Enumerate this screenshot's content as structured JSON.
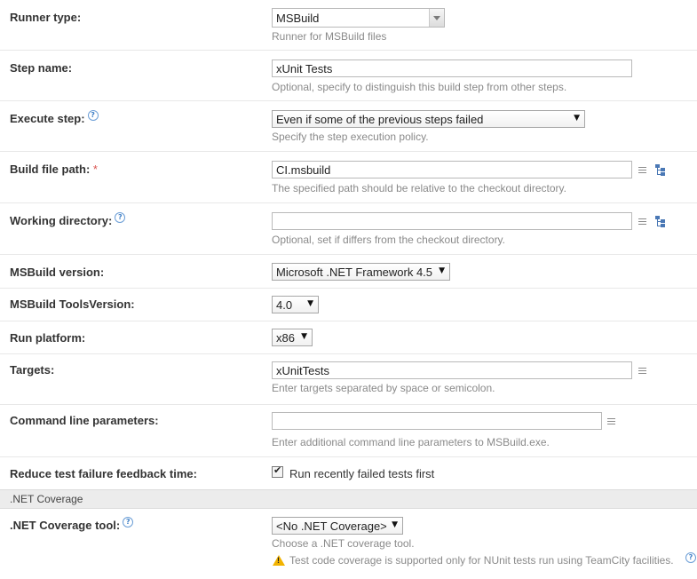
{
  "runner_type": {
    "label": "Runner type:",
    "value": "MSBuild",
    "note": "Runner for MSBuild files"
  },
  "step_name": {
    "label": "Step name:",
    "value": "xUnit Tests",
    "note": "Optional, specify to distinguish this build step from other steps."
  },
  "execute_step": {
    "label": "Execute step:",
    "help": "?",
    "value": "Even if some of the previous steps failed",
    "note": "Specify the step execution policy."
  },
  "build_file_path": {
    "label": "Build file path:",
    "required": "*",
    "value": "CI.msbuild",
    "note": "The specified path should be relative to the checkout directory."
  },
  "working_directory": {
    "label": "Working directory:",
    "help": "?",
    "value": "",
    "note": "Optional, set if differs from the checkout directory."
  },
  "msbuild_version": {
    "label": "MSBuild version:",
    "value": "Microsoft .NET Framework 4.5"
  },
  "msbuild_tools_version": {
    "label": "MSBuild ToolsVersion:",
    "value": "4.0"
  },
  "run_platform": {
    "label": "Run platform:",
    "value": "x86"
  },
  "targets": {
    "label": "Targets:",
    "value": "xUnitTests",
    "note": "Enter targets separated by space or semicolon."
  },
  "command_line": {
    "label": "Command line parameters:",
    "value": "",
    "note": "Enter additional command line parameters to MSBuild.exe."
  },
  "reduce_feedback": {
    "label": "Reduce test failure feedback time:",
    "checkbox_label": "Run recently failed tests first",
    "checked": true
  },
  "section": {
    "title": ".NET Coverage"
  },
  "coverage_tool": {
    "label": ".NET Coverage tool:",
    "help": "?",
    "value": "<No .NET Coverage>",
    "note": "Choose a .NET coverage tool.",
    "warning": "Test code coverage is supported only for NUnit tests run using TeamCity facilities.",
    "warning_help": "?"
  },
  "icons": {
    "dropdown": "triangle-down",
    "editor": "text-editor-icon",
    "tree": "tree-browse-icon",
    "help": "help-circle-icon",
    "warning": "warning-triangle-icon"
  }
}
